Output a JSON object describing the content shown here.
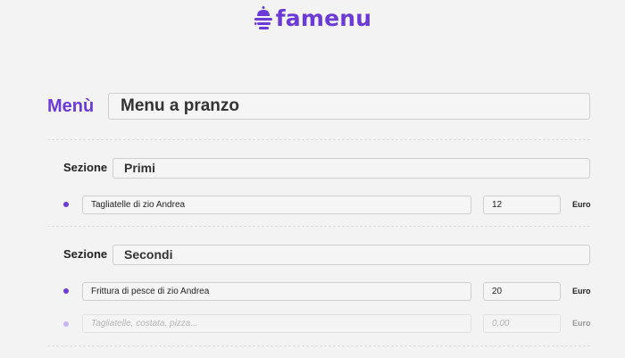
{
  "brand": {
    "name": "famenu",
    "color": "#6c3ad6",
    "icon": "burger-icon"
  },
  "menu": {
    "label": "Menù",
    "name": "Menu a pranzo"
  },
  "sections": [
    {
      "label": "Sezione",
      "name": "Primi",
      "items": [
        {
          "name": "Tagliatelle di zio Andrea",
          "price": "12",
          "currency": "Euro"
        }
      ]
    },
    {
      "label": "Sezione",
      "name": "Secondi",
      "items": [
        {
          "name": "Frittura di pesce di zio Andrea",
          "price": "20",
          "currency": "Euro"
        }
      ],
      "new_item": {
        "name_placeholder": "Tagliatelle, costata, pizza...",
        "price_placeholder": "0,00",
        "currency": "Euro"
      }
    }
  ]
}
